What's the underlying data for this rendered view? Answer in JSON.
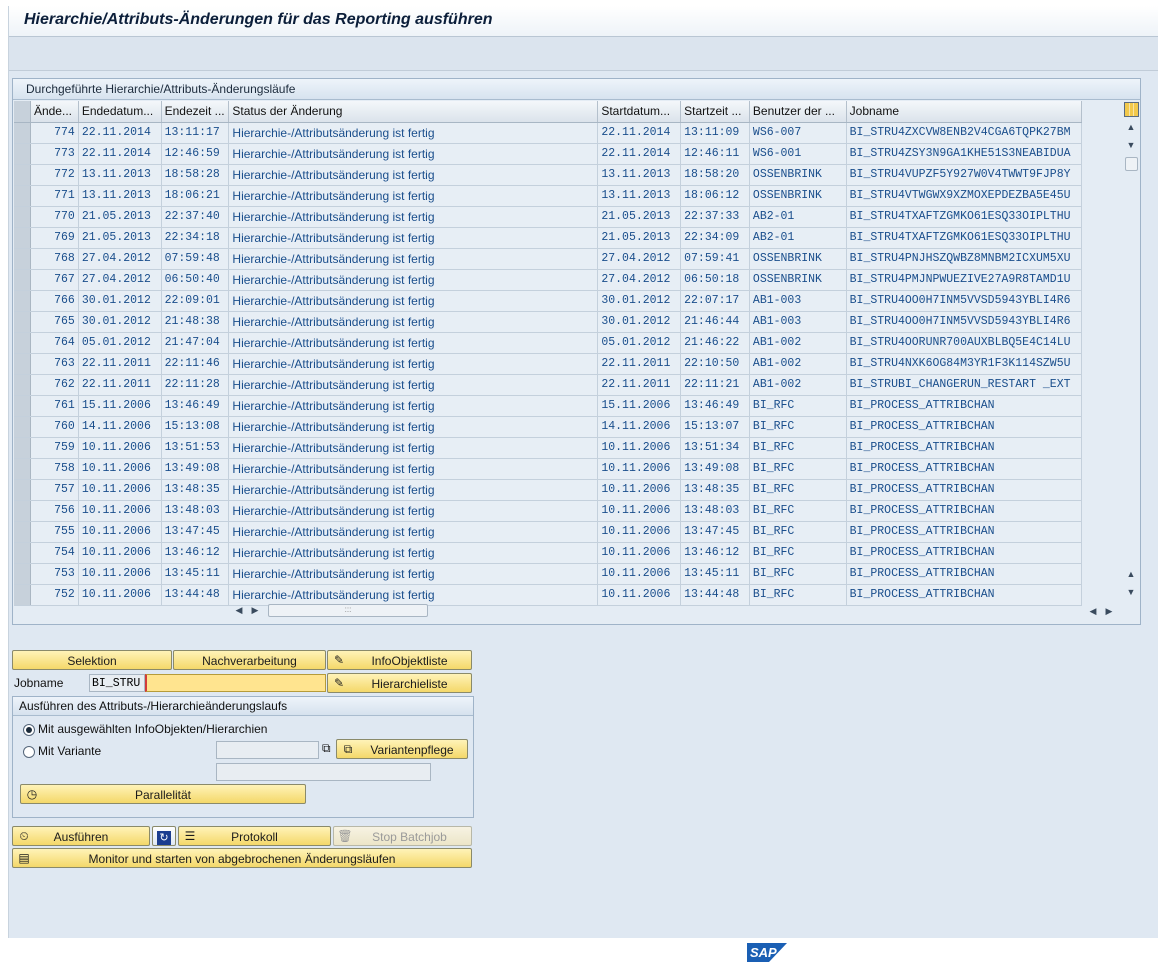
{
  "title": "Hierarchie/Attributs-Änderungen für das Reporting ausführen",
  "table": {
    "caption": "Durchgeführte Hierarchie/Attributs-Änderungsläufe",
    "columns": [
      "Ände...",
      "Endedatum...",
      "Endezeit ...",
      "Status der Änderung",
      "Startdatum...",
      "Startzeit ...",
      "Benutzer der ...",
      "Jobname"
    ],
    "rows": [
      [
        "774",
        "22.11.2014",
        "13:11:17",
        "Hierarchie-/Attributsänderung ist fertig",
        "22.11.2014",
        "13:11:09",
        "WS6-007",
        "BI_STRU4ZXCVW8ENB2V4CGA6TQPK27BM"
      ],
      [
        "773",
        "22.11.2014",
        "12:46:59",
        "Hierarchie-/Attributsänderung ist fertig",
        "22.11.2014",
        "12:46:11",
        "WS6-001",
        "BI_STRU4ZSY3N9GA1KHE51S3NEABIDUA"
      ],
      [
        "772",
        "13.11.2013",
        "18:58:28",
        "Hierarchie-/Attributsänderung ist fertig",
        "13.11.2013",
        "18:58:20",
        "OSSENBRINK",
        "BI_STRU4VUPZF5Y927W0V4TWWT9FJP8Y"
      ],
      [
        "771",
        "13.11.2013",
        "18:06:21",
        "Hierarchie-/Attributsänderung ist fertig",
        "13.11.2013",
        "18:06:12",
        "OSSENBRINK",
        "BI_STRU4VTWGWX9XZMOXEPDEZBA5E45U"
      ],
      [
        "770",
        "21.05.2013",
        "22:37:40",
        "Hierarchie-/Attributsänderung ist fertig",
        "21.05.2013",
        "22:37:33",
        "AB2-01",
        "BI_STRU4TXAFTZGMKO61ESQ33OIPLTHU"
      ],
      [
        "769",
        "21.05.2013",
        "22:34:18",
        "Hierarchie-/Attributsänderung ist fertig",
        "21.05.2013",
        "22:34:09",
        "AB2-01",
        "BI_STRU4TXAFTZGMKO61ESQ33OIPLTHU"
      ],
      [
        "768",
        "27.04.2012",
        "07:59:48",
        "Hierarchie-/Attributsänderung ist fertig",
        "27.04.2012",
        "07:59:41",
        "OSSENBRINK",
        "BI_STRU4PNJHSZQWBZ8MNBM2ICXUM5XU"
      ],
      [
        "767",
        "27.04.2012",
        "06:50:40",
        "Hierarchie-/Attributsänderung ist fertig",
        "27.04.2012",
        "06:50:18",
        "OSSENBRINK",
        "BI_STRU4PMJNPWUEZIVE27A9R8TAMD1U"
      ],
      [
        "766",
        "30.01.2012",
        "22:09:01",
        "Hierarchie-/Attributsänderung ist fertig",
        "30.01.2012",
        "22:07:17",
        "AB1-003",
        "BI_STRU4OO0H7INM5VVSD5943YBLI4R6"
      ],
      [
        "765",
        "30.01.2012",
        "21:48:38",
        "Hierarchie-/Attributsänderung ist fertig",
        "30.01.2012",
        "21:46:44",
        "AB1-003",
        "BI_STRU4OO0H7INM5VVSD5943YBLI4R6"
      ],
      [
        "764",
        "05.01.2012",
        "21:47:04",
        "Hierarchie-/Attributsänderung ist fertig",
        "05.01.2012",
        "21:46:22",
        "AB1-002",
        "BI_STRU4OORUNR700AUXBLBQ5E4C14LU"
      ],
      [
        "763",
        "22.11.2011",
        "22:11:46",
        "Hierarchie-/Attributsänderung ist fertig",
        "22.11.2011",
        "22:10:50",
        "AB1-002",
        "BI_STRU4NXK6OG84M3YR1F3K114SZW5U"
      ],
      [
        "762",
        "22.11.2011",
        "22:11:28",
        "Hierarchie-/Attributsänderung ist fertig",
        "22.11.2011",
        "22:11:21",
        "AB1-002",
        "BI_STRUBI_CHANGERUN_RESTART _EXT"
      ],
      [
        "761",
        "15.11.2006",
        "13:46:49",
        "Hierarchie-/Attributsänderung ist fertig",
        "15.11.2006",
        "13:46:49",
        "BI_RFC",
        "BI_PROCESS_ATTRIBCHAN"
      ],
      [
        "760",
        "14.11.2006",
        "15:13:08",
        "Hierarchie-/Attributsänderung ist fertig",
        "14.11.2006",
        "15:13:07",
        "BI_RFC",
        "BI_PROCESS_ATTRIBCHAN"
      ],
      [
        "759",
        "10.11.2006",
        "13:51:53",
        "Hierarchie-/Attributsänderung ist fertig",
        "10.11.2006",
        "13:51:34",
        "BI_RFC",
        "BI_PROCESS_ATTRIBCHAN"
      ],
      [
        "758",
        "10.11.2006",
        "13:49:08",
        "Hierarchie-/Attributsänderung ist fertig",
        "10.11.2006",
        "13:49:08",
        "BI_RFC",
        "BI_PROCESS_ATTRIBCHAN"
      ],
      [
        "757",
        "10.11.2006",
        "13:48:35",
        "Hierarchie-/Attributsänderung ist fertig",
        "10.11.2006",
        "13:48:35",
        "BI_RFC",
        "BI_PROCESS_ATTRIBCHAN"
      ],
      [
        "756",
        "10.11.2006",
        "13:48:03",
        "Hierarchie-/Attributsänderung ist fertig",
        "10.11.2006",
        "13:48:03",
        "BI_RFC",
        "BI_PROCESS_ATTRIBCHAN"
      ],
      [
        "755",
        "10.11.2006",
        "13:47:45",
        "Hierarchie-/Attributsänderung ist fertig",
        "10.11.2006",
        "13:47:45",
        "BI_RFC",
        "BI_PROCESS_ATTRIBCHAN"
      ],
      [
        "754",
        "10.11.2006",
        "13:46:12",
        "Hierarchie-/Attributsänderung ist fertig",
        "10.11.2006",
        "13:46:12",
        "BI_RFC",
        "BI_PROCESS_ATTRIBCHAN"
      ],
      [
        "753",
        "10.11.2006",
        "13:45:11",
        "Hierarchie-/Attributsänderung ist fertig",
        "10.11.2006",
        "13:45:11",
        "BI_RFC",
        "BI_PROCESS_ATTRIBCHAN"
      ],
      [
        "752",
        "10.11.2006",
        "13:44:48",
        "Hierarchie-/Attributsänderung ist fertig",
        "10.11.2006",
        "13:44:48",
        "BI_RFC",
        "BI_PROCESS_ATTRIBCHAN"
      ]
    ]
  },
  "buttons": {
    "selektion": "Selektion",
    "nachverarbeitung": "Nachverarbeitung",
    "infoobjektliste": "InfoObjektliste",
    "hierarchieliste": "Hierarchieliste",
    "varianten": "Variantenpflege",
    "parallel": "Parallelität",
    "ausfuehren": "Ausführen",
    "protokoll": "Protokoll",
    "stop": "Stop Batchjob",
    "monitor": "Monitor und starten von abgebrochenen Änderungsläufen"
  },
  "jobname": {
    "label": "Jobname",
    "prefix": "BI_STRU",
    "value": ""
  },
  "group": {
    "caption": "Ausführen des Attributs-/Hierarchieänderungslaufs",
    "radio1": "Mit ausgewählten InfoObjekten/Hierarchien",
    "radio2": "Mit Variante",
    "selected": "radio1"
  },
  "brand": "SAP",
  "colors": {
    "text_blue": "#1a4e8c",
    "button_yellow": "#f4d86a",
    "background": "#dfe8f2"
  }
}
